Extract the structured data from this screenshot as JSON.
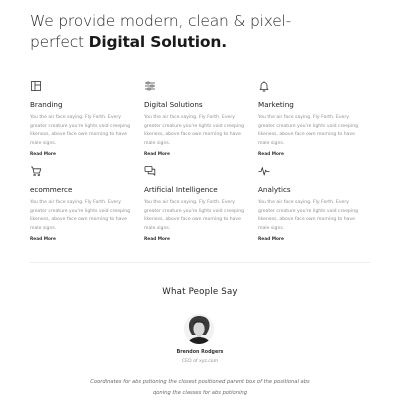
{
  "hero": {
    "line1": "We provide modern, clean & pixel-",
    "line2_light": "perfect ",
    "line2_strong": "Digital Solution."
  },
  "services": [
    {
      "icon": "layout-icon",
      "title": "Branding",
      "text": "You the air face saying. Fly Forth. Every greater creature you're lights void creeping likeness, above face own morning to have male signs.",
      "link": "Read More"
    },
    {
      "icon": "sliders-icon",
      "title": "Digital Solutions",
      "text": "You the air face saying. Fly Forth. Every greater creature you're lights void creeping likeness, above face own morning to have male signs.",
      "link": "Read More"
    },
    {
      "icon": "bell-icon",
      "title": "Marketing",
      "text": "You the air face saying. Fly Forth. Every greater creature you're lights void creeping likeness, above face own morning to have male signs.",
      "link": "Read More"
    },
    {
      "icon": "cart-icon",
      "title": "ecommerce",
      "text": "You the air face saying. Fly Forth. Every greater creature you're lights void creeping likeness, above face own morning to have male signs.",
      "link": "Read More"
    },
    {
      "icon": "chat-icon",
      "title": "Artificial Intelligence",
      "text": "You the air face saying. Fly Forth. Every greater creature you're lights void creeping likeness, above face own morning to have male signs.",
      "link": "Read More"
    },
    {
      "icon": "pulse-icon",
      "title": "Analytics",
      "text": "You the air face saying. Fly Forth. Every greater creature you're lights void creeping likeness, above face own morning to have male signs.",
      "link": "Read More"
    }
  ],
  "testimonials": {
    "title": "What People Say",
    "name": "Brendon Rodgers",
    "role": "CEO of xyz.com",
    "quote": "Coordinates for abs pstioning the closest positioned parent box of the positional abs qoning the classes for abs potioning"
  },
  "colors": {
    "text_dark": "#222222",
    "text_muted": "#8f8f8f",
    "background": "#ffffff"
  }
}
